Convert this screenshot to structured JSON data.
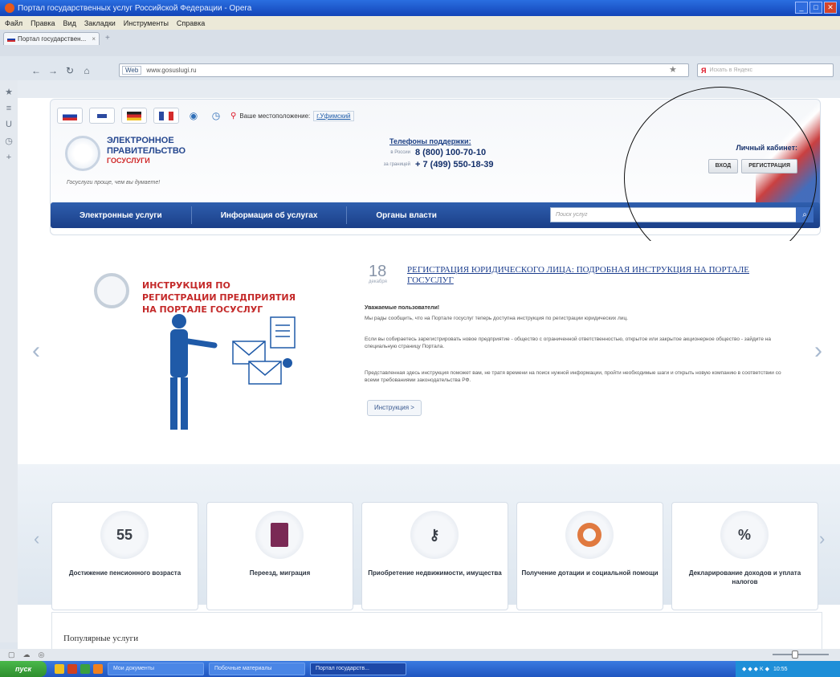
{
  "window": {
    "title": "Портал государственных услуг Российской Федерации - Opera"
  },
  "menu": [
    "Файл",
    "Правка",
    "Вид",
    "Закладки",
    "Инструменты",
    "Справка"
  ],
  "tab": {
    "label": "Портал государствен..."
  },
  "address": {
    "site": "Web",
    "url": "www.gosuslugi.ru"
  },
  "search": {
    "placeholder": "Искать в Яндекс"
  },
  "header": {
    "location_label": "Ваше местоположение:",
    "location_value": "г.Уфимский",
    "logo_line1": "ЭЛЕКТРОННОЕ",
    "logo_line2": "ПРАВИТЕЛЬСТВО",
    "logo_line3": "ГОСУСЛУГИ",
    "slogan": "Госуслуги проще, чем вы думаете!",
    "support_title": "Телефоны поддержки:",
    "phones": [
      {
        "label": "в России",
        "number": "8 (800) 100-70-10"
      },
      {
        "label": "за границей",
        "number": "+ 7 (499) 550-18-39"
      }
    ],
    "cabinet_title": "Личный кабинет:",
    "login": "ВХОД",
    "register": "РЕГИСТРАЦИЯ"
  },
  "mainnav": {
    "items": [
      "Электронные услуги",
      "Информация об услугах",
      "Органы власти"
    ],
    "search_placeholder": "Поиск услуг"
  },
  "slide": {
    "promo_title": "ИНСТРУКЦИЯ ПО РЕГИСТРАЦИИ ПРЕДПРИЯТИЯ НА ПОРТАЛЕ ГОСУСЛУГ",
    "date_day": "18",
    "date_month": "декабря",
    "title": "РЕГИСТРАЦИЯ ЮРИДИЧЕСКОГО ЛИЦА: ПОДРОБНАЯ ИНСТРУКЦИЯ НА ПОРТАЛЕ ГОСУСЛУГ",
    "lead": "Уважаемые пользователи!",
    "p1": "Мы рады сообщить, что на Портале госуслуг теперь доступна инструкция по регистрации юридических лиц.",
    "p2": "Если вы собираетесь зарегистрировать новое предприятие - общество с ограниченной ответственностью, открытое или закрытое акционерное общество - зайдите на специальную страницу Портала.",
    "p3": "Представленная здесь инструкция поможет вам, не тратя времени на поиск нужной информации, пройти необходимые шаги и открыть новую компанию в соответствии со всеми требованиями законодательства РФ.",
    "button": "Инструкция >"
  },
  "dots": {
    "count": 9,
    "active": 0
  },
  "services": [
    {
      "icon": "55",
      "label": "Достижение пенсионного возраста"
    },
    {
      "icon": "",
      "label": "Переезд, миграция"
    },
    {
      "icon": "",
      "label": "Приобретение недвижимости, имущества"
    },
    {
      "icon": "",
      "label": "Получение дотации и социальной помощи"
    },
    {
      "icon": "%",
      "label": "Декларирование доходов и уплата налогов"
    }
  ],
  "popular": {
    "title": "Популярные услуги"
  },
  "taskbar": {
    "start": "пуск",
    "tasks": [
      "Мои документы",
      "Побочные материалы",
      "Портал государств..."
    ],
    "clock": "10:55"
  }
}
